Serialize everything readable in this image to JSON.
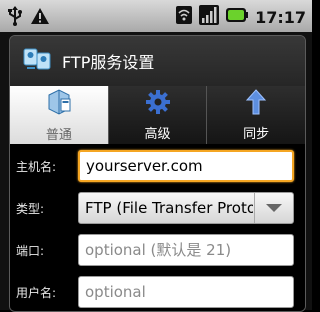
{
  "status_bar": {
    "time": "17:17",
    "icons": [
      "usb-icon",
      "warning-icon",
      "wifi-icon",
      "signal-icon",
      "battery-icon"
    ]
  },
  "dialog": {
    "title": "FTP服务设置",
    "icon": "ftp-server-icon",
    "tabs": [
      {
        "label": "普通",
        "icon": "general-icon",
        "active": true
      },
      {
        "label": "高级",
        "icon": "gear-icon",
        "active": false
      },
      {
        "label": "同步",
        "icon": "sync-arrow-icon",
        "active": false
      }
    ],
    "fields": {
      "host": {
        "label": "主机名:",
        "value": "yourserver.com"
      },
      "type": {
        "label": "类型:",
        "value": "FTP (File Transfer Proto"
      },
      "port": {
        "label": "端口:",
        "placeholder": "optional (默认是 21)"
      },
      "username": {
        "label": "用户名:",
        "placeholder": "optional"
      }
    }
  },
  "colors": {
    "focus_border": "#f5a623",
    "battery": "#6bd22c",
    "gear": "#3b6fd1"
  }
}
